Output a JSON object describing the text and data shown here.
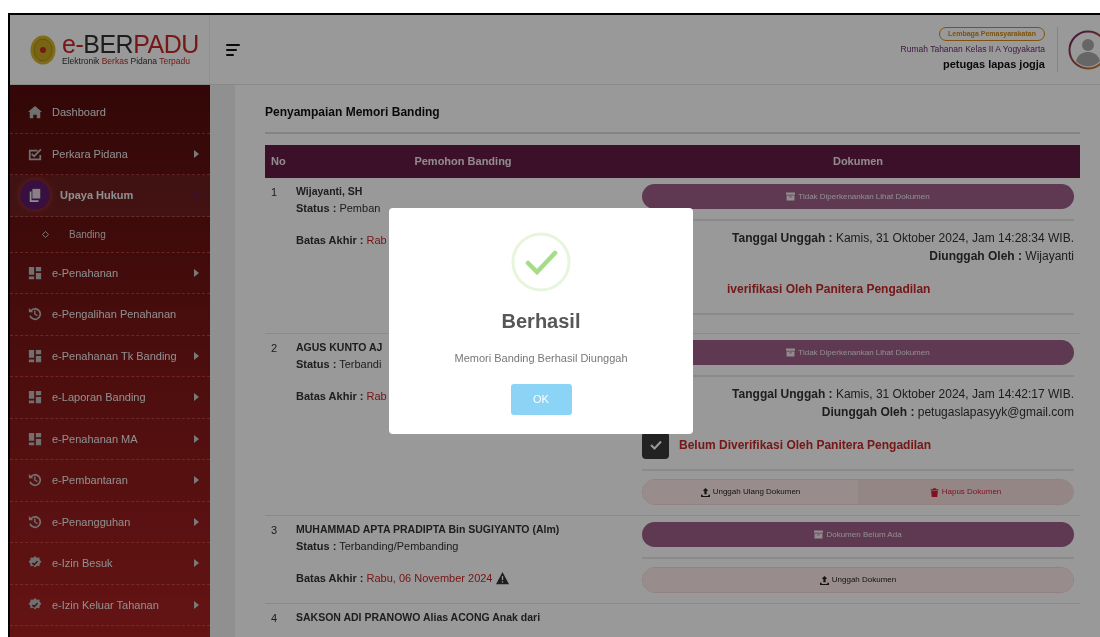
{
  "header": {
    "logo_title": [
      "e-",
      "BER",
      "PADU"
    ],
    "logo_subtitle": [
      "Elektronik ",
      "Berkas",
      " Pidana ",
      "Terpadu"
    ],
    "user_role_badge": "Lembaga Pemasyarakatan",
    "user_org": "Rumah Tahanan Kelas II A Yogyakarta",
    "user_name": "petugas lapas jogja"
  },
  "sidebar": {
    "items": [
      {
        "label": "Dashboard",
        "kind": "home",
        "arrow": false,
        "selected": false
      },
      {
        "label": "Perkara Pidana",
        "kind": "check",
        "arrow": true,
        "selected": false
      },
      {
        "label": "Upaya Hukum",
        "kind": "copy",
        "arrow": true,
        "selected": true,
        "expanded": true,
        "children": [
          {
            "label": "Banding"
          }
        ]
      },
      {
        "label": "e-Penahanan",
        "kind": "grid",
        "arrow": true,
        "selected": false
      },
      {
        "label": "e-Pengalihan Penahanan",
        "kind": "history",
        "arrow": false,
        "selected": false
      },
      {
        "label": "e-Penahanan Tk Banding",
        "kind": "grid",
        "arrow": true,
        "selected": false
      },
      {
        "label": "e-Laporan Banding",
        "kind": "grid",
        "arrow": true,
        "selected": false
      },
      {
        "label": "e-Penahanan MA",
        "kind": "grid",
        "arrow": true,
        "selected": false
      },
      {
        "label": "e-Pembantaran",
        "kind": "history",
        "arrow": true,
        "selected": false
      },
      {
        "label": "e-Penangguhan",
        "kind": "history",
        "arrow": true,
        "selected": false
      },
      {
        "label": "e-Izin Besuk",
        "kind": "badge",
        "arrow": true,
        "selected": false
      },
      {
        "label": "e-Izin Keluar Tahanan",
        "kind": "badge",
        "arrow": true,
        "selected": false
      }
    ]
  },
  "page_title": "Penyampaian Memori Banding",
  "table": {
    "columns": [
      "No",
      "Pemohon Banding",
      "Dokumen"
    ],
    "rows": [
      {
        "no": "1",
        "name": "Wijayanti, SH",
        "status_label": "Status :",
        "status": "Pemban",
        "deadline_label": "Batas Akhir :",
        "deadline": "Rab",
        "warning": false,
        "document": {
          "button": "Tidak Diperkenankan Lihat Dokumen",
          "upload_date_label": "Tanggal Unggah :",
          "upload_date": "Kamis, 31 Oktober 2024, Jam 14:28:34 WIB.",
          "uploader_label": "Diunggah Oleh :",
          "uploader": "Wijayanti",
          "verification": "iverifikasi Oleh Panitera Pengadilan"
        }
      },
      {
        "no": "2",
        "name": "AGUS KUNTO AJ",
        "status_label": "Status :",
        "status": "Terbandi",
        "deadline_label": "Batas Akhir :",
        "deadline": "Rab",
        "warning": false,
        "document": {
          "button": "Tidak Diperkenankan Lihat Dokumen",
          "upload_date_label": "Tanggal Unggah :",
          "upload_date": "Kamis, 31 Oktober 2024, Jam 14:42:17 WIB.",
          "uploader_label": "Diunggah Oleh :",
          "uploader": "petugaslapasyyk@gmail.com",
          "checked": true,
          "verification": "Belum Diverifikasi Oleh Panitera Pengadilan",
          "actions": [
            {
              "label": "Unggah Ulang Dokumen",
              "kind": "upload"
            },
            {
              "label": "Hapus Dokumen",
              "kind": "delete"
            }
          ]
        }
      },
      {
        "no": "3",
        "name": "MUHAMMAD APTA PRADIPTA Bin SUGIYANTO (Alm)",
        "status_label": "Status :",
        "status": "Terbanding/Pembanding",
        "deadline_label": "Batas Akhir :",
        "deadline": "Rabu, 06 November 2024",
        "warning": true,
        "document": {
          "button": "Dokumen Belum Ada",
          "actions": [
            {
              "label": "Unggah Dokumen",
              "kind": "upload"
            }
          ]
        }
      },
      {
        "no": "4",
        "name": "SAKSON ADI PRANOWO Alias ACONG Anak dari"
      }
    ]
  },
  "dialog": {
    "title": "Berhasil",
    "message": "Memori Banding Berhasil Diunggah",
    "button": "OK"
  }
}
